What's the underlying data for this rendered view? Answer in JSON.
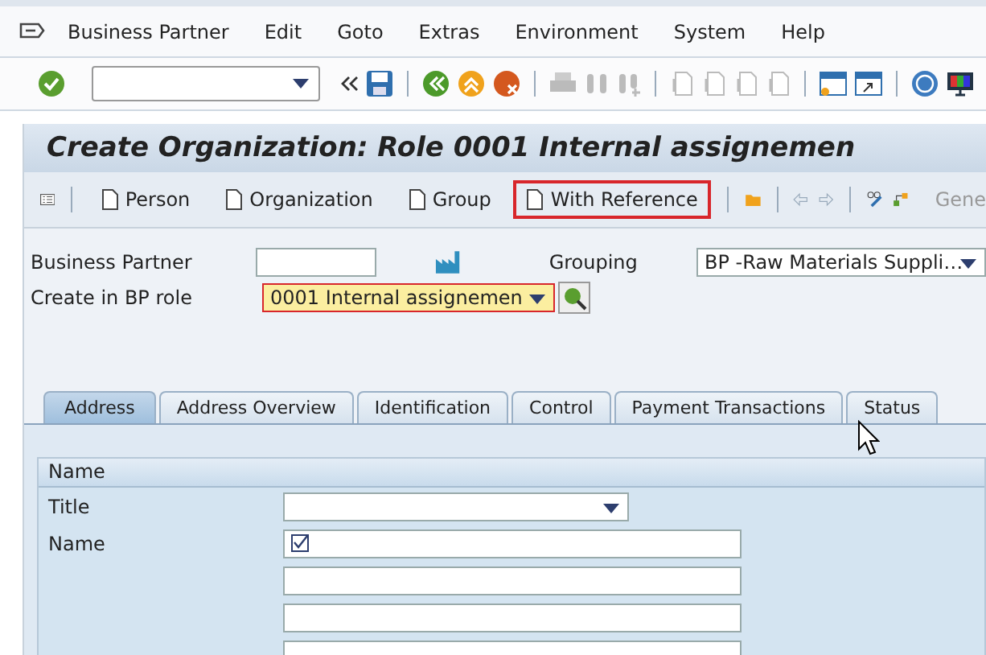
{
  "menu": {
    "items": [
      "Business Partner",
      "Edit",
      "Goto",
      "Extras",
      "Environment",
      "System",
      "Help"
    ]
  },
  "title": "Create Organization: Role 0001 Internal assignemen",
  "app_toolbar": {
    "buttons": [
      {
        "label": "Person",
        "highlighted": false
      },
      {
        "label": "Organization",
        "highlighted": false
      },
      {
        "label": "Group",
        "highlighted": false
      },
      {
        "label": "With Reference",
        "highlighted": true
      }
    ],
    "cut_label": "Gene"
  },
  "form": {
    "business_partner": {
      "label": "Business Partner"
    },
    "grouping": {
      "label": "Grouping",
      "value": "BP -Raw Materials Suppli…"
    },
    "bp_role": {
      "label": "Create in BP role",
      "value": "0001 Internal  assignemen"
    }
  },
  "tabs": [
    {
      "label": "Address",
      "selected": true
    },
    {
      "label": "Address Overview",
      "selected": false
    },
    {
      "label": "Identification",
      "selected": false
    },
    {
      "label": "Control",
      "selected": false
    },
    {
      "label": "Payment Transactions",
      "selected": false
    },
    {
      "label": "Status",
      "selected": false
    }
  ],
  "name_section": {
    "title": "Name",
    "fields": [
      {
        "label": "Title",
        "kind": "dropdown"
      },
      {
        "label": "Name",
        "kind": "text-with-icon"
      },
      {
        "kind": "text"
      },
      {
        "kind": "text"
      },
      {
        "kind": "text"
      }
    ]
  }
}
